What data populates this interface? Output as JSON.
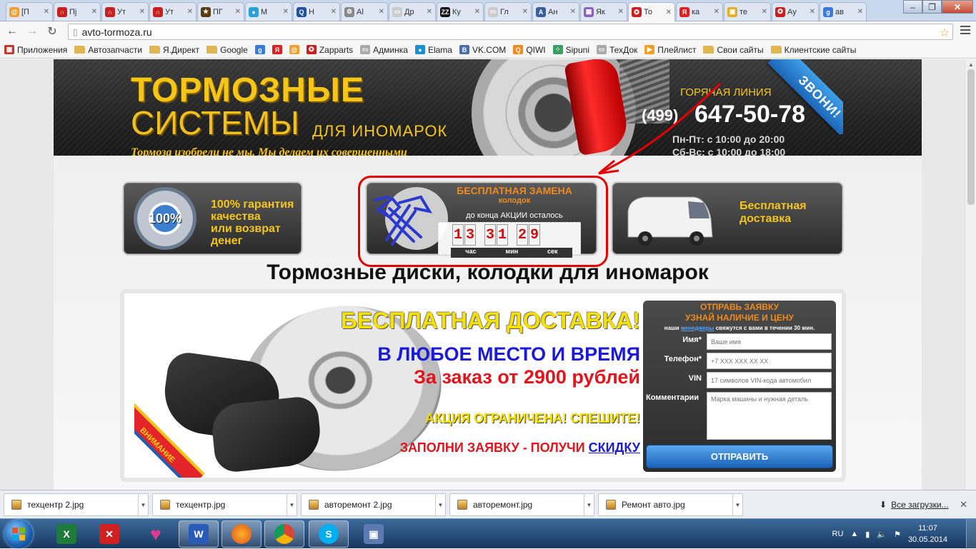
{
  "tabs": [
    {
      "label": "[П",
      "color": "#f0a030",
      "glyph": "@"
    },
    {
      "label": "Пј",
      "color": "#c82020",
      "glyph": "∩"
    },
    {
      "label": "Ут",
      "color": "#c82020",
      "glyph": "∩"
    },
    {
      "label": "Ут",
      "color": "#c82020",
      "glyph": "∩"
    },
    {
      "label": "ПГ",
      "color": "#5a3a10",
      "glyph": "★"
    },
    {
      "label": "М",
      "color": "#2aa0d8",
      "glyph": "●"
    },
    {
      "label": "Н",
      "color": "#2050a0",
      "glyph": "Q"
    },
    {
      "label": "Al",
      "color": "#888888",
      "glyph": "⚙"
    },
    {
      "label": "Др",
      "color": "#cccccc",
      "glyph": "▭"
    },
    {
      "label": "Ку",
      "color": "#111111",
      "glyph": "ZZ"
    },
    {
      "label": "Гл",
      "color": "#cccccc",
      "glyph": "▭"
    },
    {
      "label": "Ан",
      "color": "#3a60a0",
      "glyph": "A"
    },
    {
      "label": "Як",
      "color": "#9060c0",
      "glyph": "▦"
    },
    {
      "label": "То",
      "color": "#c82020",
      "glyph": "✪"
    },
    {
      "label": "ка",
      "color": "#e02020",
      "glyph": "Я"
    },
    {
      "label": "те",
      "color": "#e0b020",
      "glyph": "▣"
    },
    {
      "label": "Ау",
      "color": "#c82020",
      "glyph": "✪"
    },
    {
      "label": "ав",
      "color": "#3a7ad8",
      "glyph": "g"
    }
  ],
  "active_tab": 13,
  "address": "avto-tormoza.ru",
  "bookmarks": [
    {
      "label": "Приложения",
      "kind": "apps"
    },
    {
      "label": "Автозапчасти",
      "kind": "folder"
    },
    {
      "label": "Я.Директ",
      "kind": "folder"
    },
    {
      "label": "Google",
      "kind": "folder"
    },
    {
      "label": "",
      "kind": "g"
    },
    {
      "label": "",
      "kind": "ya"
    },
    {
      "label": "",
      "kind": "mail"
    },
    {
      "label": "Zapparts",
      "kind": "zap"
    },
    {
      "label": "Админка",
      "kind": "page"
    },
    {
      "label": "Elama",
      "kind": "elama"
    },
    {
      "label": "VK.COM",
      "kind": "vk"
    },
    {
      "label": "QIWI",
      "kind": "qiwi"
    },
    {
      "label": "Sipuni",
      "kind": "sipuni"
    },
    {
      "label": "ТехДок",
      "kind": "page"
    },
    {
      "label": "Плейлист",
      "kind": "play"
    },
    {
      "label": "Свои сайты",
      "kind": "folder"
    },
    {
      "label": "Клиентские сайты",
      "kind": "folder"
    }
  ],
  "site": {
    "logo_line1": "ТОРМОЗНЫЕ",
    "logo_line2": "СИСТЕМЫ",
    "logo_line3": "ДЛЯ ИНОМАРОК",
    "slogan": "Тормоза изобрели не мы. Мы делаем их совершенными",
    "hotline_label": "ГОРЯЧАЯ ЛИНИЯ",
    "phone_code": "(499)",
    "phone": "647-50-78",
    "hours_weekday": "Пн-Пт: с 10:00 до 20:00",
    "hours_weekend": "Сб-Вс: с 10:00 до 18:00",
    "ribbon": "ЗВОНИ!",
    "promo1": {
      "seal": "100%",
      "line1": "100% гарантия",
      "line2": "качества",
      "line3": "или возврат денег"
    },
    "promo2": {
      "title": "БЕСПЛАТНАЯ ЗАМЕНА",
      "subtitle": "колодок",
      "countdown_label": "до конца АКЦИИ осталось",
      "hours": [
        "1",
        "3"
      ],
      "minutes": [
        "3",
        "1"
      ],
      "seconds": [
        "2",
        "9"
      ],
      "unit_hours": "час",
      "unit_minutes": "мин",
      "unit_seconds": "сек"
    },
    "promo3": {
      "line1": "Бесплатная",
      "line2": "доставка"
    },
    "heading": "Тормозные диски, колодки для иномарок",
    "banner": {
      "line1": "БЕСПЛАТНАЯ ДОСТАВКА!",
      "line2": "В ЛЮБОЕ МЕСТО И ВРЕМЯ",
      "line3": "За заказ от 2900 рублей",
      "line4": "АКЦИЯ ОГРАНИЧЕНА! СПЕШИТЕ!",
      "line5": "ЗАПОЛНИ ЗАЯВКУ - ПОЛУЧИ",
      "line5_link": "СКИДКУ",
      "corner": "ВНИМАНИЕ"
    },
    "form": {
      "title1": "ОТПРАВЬ ЗАЯВКУ",
      "title2": "УЗНАЙ НАЛИЧИЕ И ЦЕНУ",
      "note_pre": "наши",
      "note_link": "менеджеры",
      "note_post": "свяжутся с вами в течении 30 мин.",
      "name_label": "Имя*",
      "name_placeholder": "Ваше имя",
      "phone_label": "Телефон*",
      "phone_placeholder": "+7 XXX XXX XX XX",
      "vin_label": "VIN",
      "vin_placeholder": "17 символов VIN-кода автомобил",
      "comment_label": "Комментарии",
      "comment_placeholder": "Марка машины и нужная деталь",
      "submit": "ОТПРАВИТЬ"
    }
  },
  "downloads": [
    "техцентр 2.jpg",
    "техцентр.jpg",
    "авторемонт 2.jpg",
    "авторемонт.jpg",
    "Ремонт авто.jpg"
  ],
  "all_downloads": "Все загрузки...",
  "taskbar": {
    "lang": "RU",
    "time": "11:07",
    "date": "30.05.2014"
  },
  "colors": {
    "accent_yellow": "#f5c518",
    "accent_orange": "#f08a1c",
    "highlight_red": "#e50000",
    "link_blue": "#1a1ad8"
  }
}
